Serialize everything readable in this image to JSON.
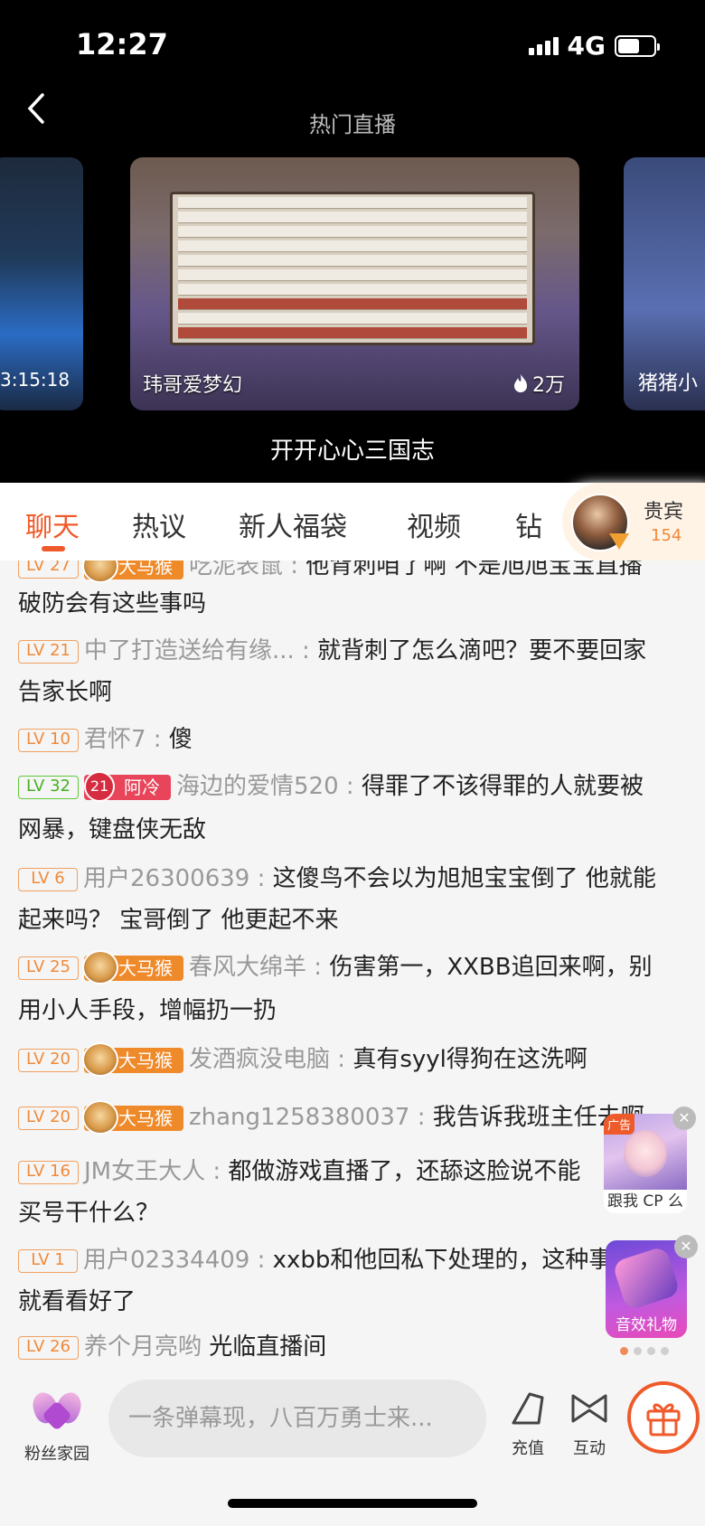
{
  "status_bar": {
    "time": "12:27",
    "network": "4G"
  },
  "header": {
    "title": "热门直播"
  },
  "carousel": {
    "left_card": {
      "duration": "3:15:18"
    },
    "center_card": {
      "name": "玮哥爱梦幻",
      "heat": "2万"
    },
    "right_card": {
      "name": "猪猪小"
    },
    "current_title": "开开心心三国志"
  },
  "tabs": [
    "聊天",
    "热议",
    "新人福袋",
    "视频",
    "钻"
  ],
  "vip": {
    "label": "贵宾",
    "count": "154"
  },
  "chat": [
    {
      "level": "LV 27",
      "badge": "大马猴",
      "user": "吃泥表鼠",
      "text": "他背刺咱了啊 不是旭旭宝宝直播"
    },
    {
      "text": "破防会有这些事吗"
    },
    {
      "level": "LV 21",
      "user": "中了打造送给有缘...",
      "text": "就背刺了怎么滴吧？要不要回家"
    },
    {
      "text": "告家长啊"
    },
    {
      "level": "LV 10",
      "user": "君怀7",
      "text": "傻"
    },
    {
      "level": "LV 32",
      "badge_num": "21",
      "badge": "阿冷",
      "user": "海边的爱情520",
      "text": "得罪了不该得罪的人就要被"
    },
    {
      "text": "网暴，键盘侠无敌"
    },
    {
      "level": "LV 6",
      "user": "用户26300639",
      "text": "这傻鸟不会以为旭旭宝宝倒了 他就能"
    },
    {
      "text": "起来吗？ 宝哥倒了 他更起不来"
    },
    {
      "level": "LV 25",
      "badge": "大马猴",
      "user": "春风大绵羊",
      "text": "伤害第一，XXBB追回来啊，别"
    },
    {
      "text": "用小人手段，增幅扔一扔"
    },
    {
      "level": "LV 20",
      "badge": "大马猴",
      "user": "发酒疯没电脑",
      "text": "真有syyl得狗在这洗啊"
    },
    {
      "level": "LV 20",
      "badge": "大马猴",
      "user": "zhang1258380037",
      "text": "我告诉我班主任去啊"
    },
    {
      "level": "LV 16",
      "user": "JM女王大人",
      "text": "都做游戏直播了，还舔这脸说不能"
    },
    {
      "text": "买号干什么？"
    },
    {
      "level": "LV 1",
      "user": "用户02334409",
      "text": "xxbb和他回私下处理的，这种事"
    },
    {
      "text": "就看看好了"
    },
    {
      "level": "LV 26",
      "user": "养个月亮哟",
      "text": "光临直播间"
    }
  ],
  "ads": {
    "cp_tag": "广告",
    "cp_caption": "跟我 CP 么",
    "gift_caption": "音效礼物"
  },
  "bottom": {
    "fans_label": "粉丝家园",
    "input_placeholder": "一条弹幕现，八百万勇士来...",
    "recharge_label": "充值",
    "interact_label": "互动"
  },
  "colors": {
    "accent": "#ef5a2a",
    "level_orange": "#f08a3a",
    "level_green": "#45b020"
  }
}
